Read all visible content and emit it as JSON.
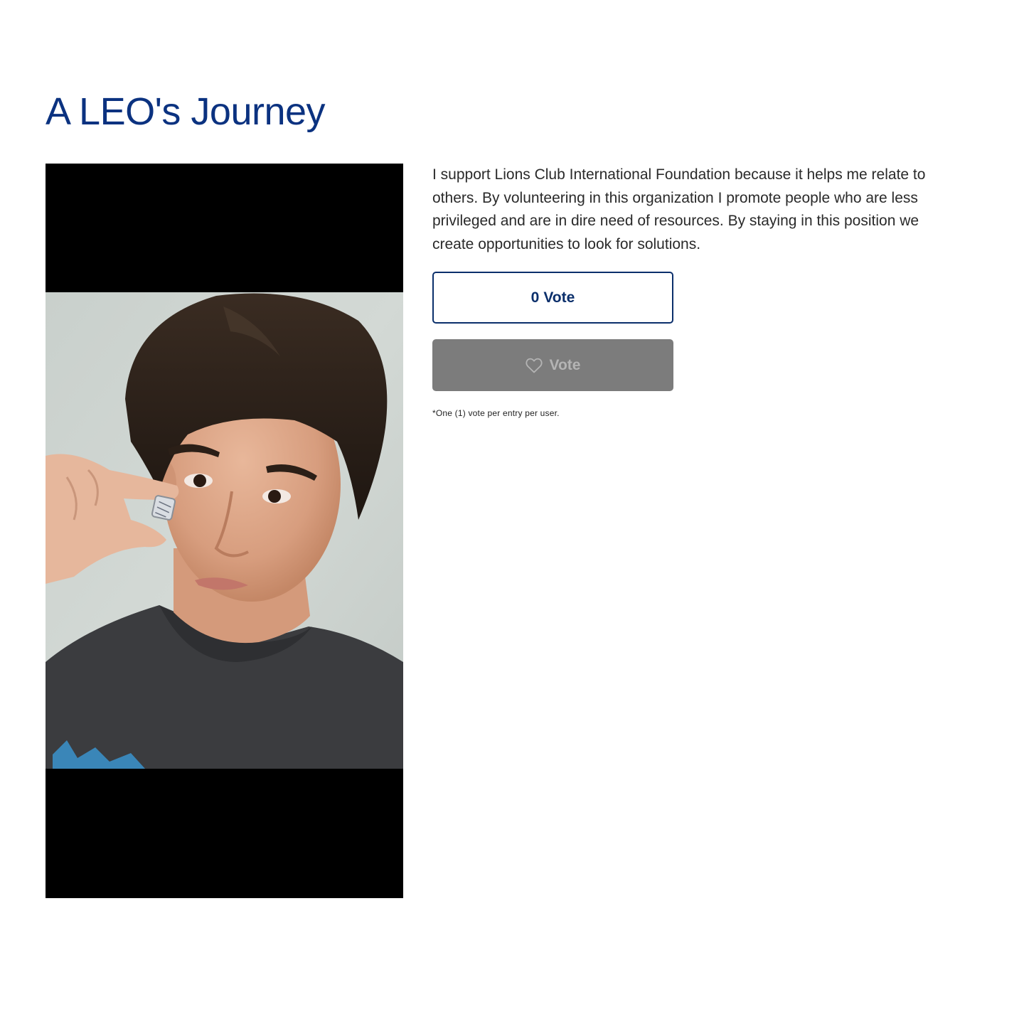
{
  "page": {
    "title": "A LEO's Journey"
  },
  "entry": {
    "photo_icon": "portrait-photo",
    "description": "I support Lions Club International Foundation because it helps me relate to others. By volunteering in this organization I promote people who are less privileged and are in dire need of resources. By staying in this position we create opportunities to look for solutions."
  },
  "voting": {
    "count": "0",
    "count_label": "Vote",
    "button_label": "Vote",
    "button_icon": "heart-icon",
    "button_enabled": false,
    "note": "*One (1) vote per entry per user."
  },
  "colors": {
    "title": "#0b3280",
    "accent": "#0b2f6b",
    "disabled_button": "#7c7c7c",
    "disabled_text": "#b4b4b4"
  }
}
